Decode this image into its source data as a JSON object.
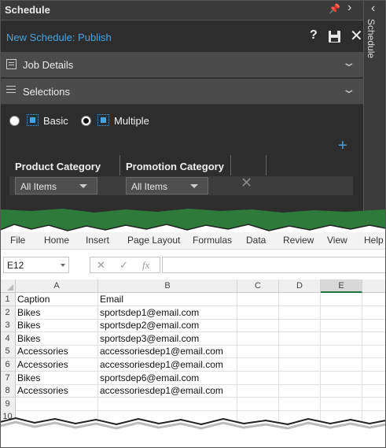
{
  "panel": {
    "title": "Schedule",
    "side_tab_label": "Schedule",
    "schedule_name": "New Schedule: Publish",
    "help_label": "?",
    "sections": [
      {
        "label": "Job Details"
      },
      {
        "label": "Selections"
      }
    ],
    "modes": [
      {
        "label": "Basic",
        "selected": false
      },
      {
        "label": "Multiple",
        "selected": true
      }
    ],
    "add_label": "+",
    "selection_columns": [
      {
        "header": "Product Category",
        "value": "All Items"
      },
      {
        "header": "Promotion Category",
        "value": "All Items"
      }
    ]
  },
  "excel": {
    "ribbon_tabs": [
      "File",
      "Home",
      "Insert",
      "Page Layout",
      "Formulas",
      "Data",
      "Review",
      "View",
      "Help"
    ],
    "name_box": "E12",
    "formula_icons": [
      "✕",
      "✓",
      "fx"
    ],
    "columns": [
      "A",
      "B",
      "C",
      "D",
      "E"
    ],
    "selected_column": "E",
    "row_numbers": [
      "1",
      "2",
      "3",
      "4",
      "5",
      "6",
      "7",
      "8",
      "9",
      "10"
    ],
    "rows": [
      [
        "Caption",
        "Email"
      ],
      [
        "Bikes",
        "sportsdep1@email.com"
      ],
      [
        "Bikes",
        "sportsdep2@email.com"
      ],
      [
        "Bikes",
        "sportsdep3@email.com"
      ],
      [
        "Accessories",
        "accessoriesdep1@email.com"
      ],
      [
        "Accessories",
        "accessoriesdep1@email.com"
      ],
      [
        "Bikes",
        "sportsdep6@email.com"
      ],
      [
        "Accessories",
        "accessoriesdep1@email.com"
      ],
      [
        "",
        ""
      ],
      [
        "",
        ""
      ]
    ]
  },
  "colors": {
    "panel_bg": "#2d2d2d",
    "accent_blue": "#4aa3df",
    "excel_green": "#217346"
  }
}
